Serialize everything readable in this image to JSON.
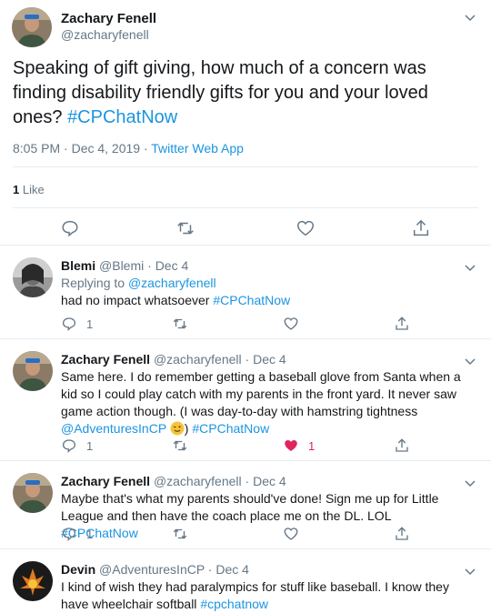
{
  "main_tweet": {
    "name": "Zachary Fenell",
    "handle": "@zacharyfenell",
    "text": "Speaking of gift giving, how much of a concern was finding disability friendly gifts for you and your loved ones?",
    "hashtag": "#CPChatNow",
    "time": "8:05 PM · Dec 4, 2019 · ",
    "source": "Twitter Web App",
    "likes_count": "1",
    "likes_label": "Like"
  },
  "replies": [
    {
      "name": "Blemi",
      "handle": "@Blemi",
      "date": "Dec 4",
      "replying_label": "Replying to",
      "replying_to": "@zacharyfenell",
      "text": "had no impact whatsoever",
      "hashtag": "#CPChatNow",
      "reply_count": "1",
      "like_count": ""
    },
    {
      "name": "Zachary Fenell",
      "handle": "@zacharyfenell",
      "date": "Dec 4",
      "text_1": "Same here. I do remember getting a baseball glove from Santa when a kid so I could play catch with my parents in the front yard. It never saw game action though. (I was day-to-day with hamstring tightness",
      "mention": "@AdventuresInCP",
      "text_2": ")",
      "hashtag": "#CPChatNow",
      "reply_count": "1",
      "like_count": "1"
    },
    {
      "name": "Zachary Fenell",
      "handle": "@zacharyfenell",
      "date": "Dec 4",
      "text": "Maybe that's what my parents should've done! Sign me up for Little League and then have the coach place me on the DL. LOL",
      "hashtag": "#CPChatNow",
      "reply_count": "1",
      "like_count": ""
    },
    {
      "name": "Devin",
      "handle": "@AdventuresInCP",
      "date": "Dec 4",
      "text": "I kind of wish they had paralympics for stuff like baseball. I know they have wheelchair softball",
      "hashtag": "#cpchatnow"
    }
  ],
  "separator": " · ",
  "colors": {
    "link": "#1b95e0",
    "muted": "#657786",
    "like": "#e0245e",
    "border": "#e6ecf0"
  }
}
